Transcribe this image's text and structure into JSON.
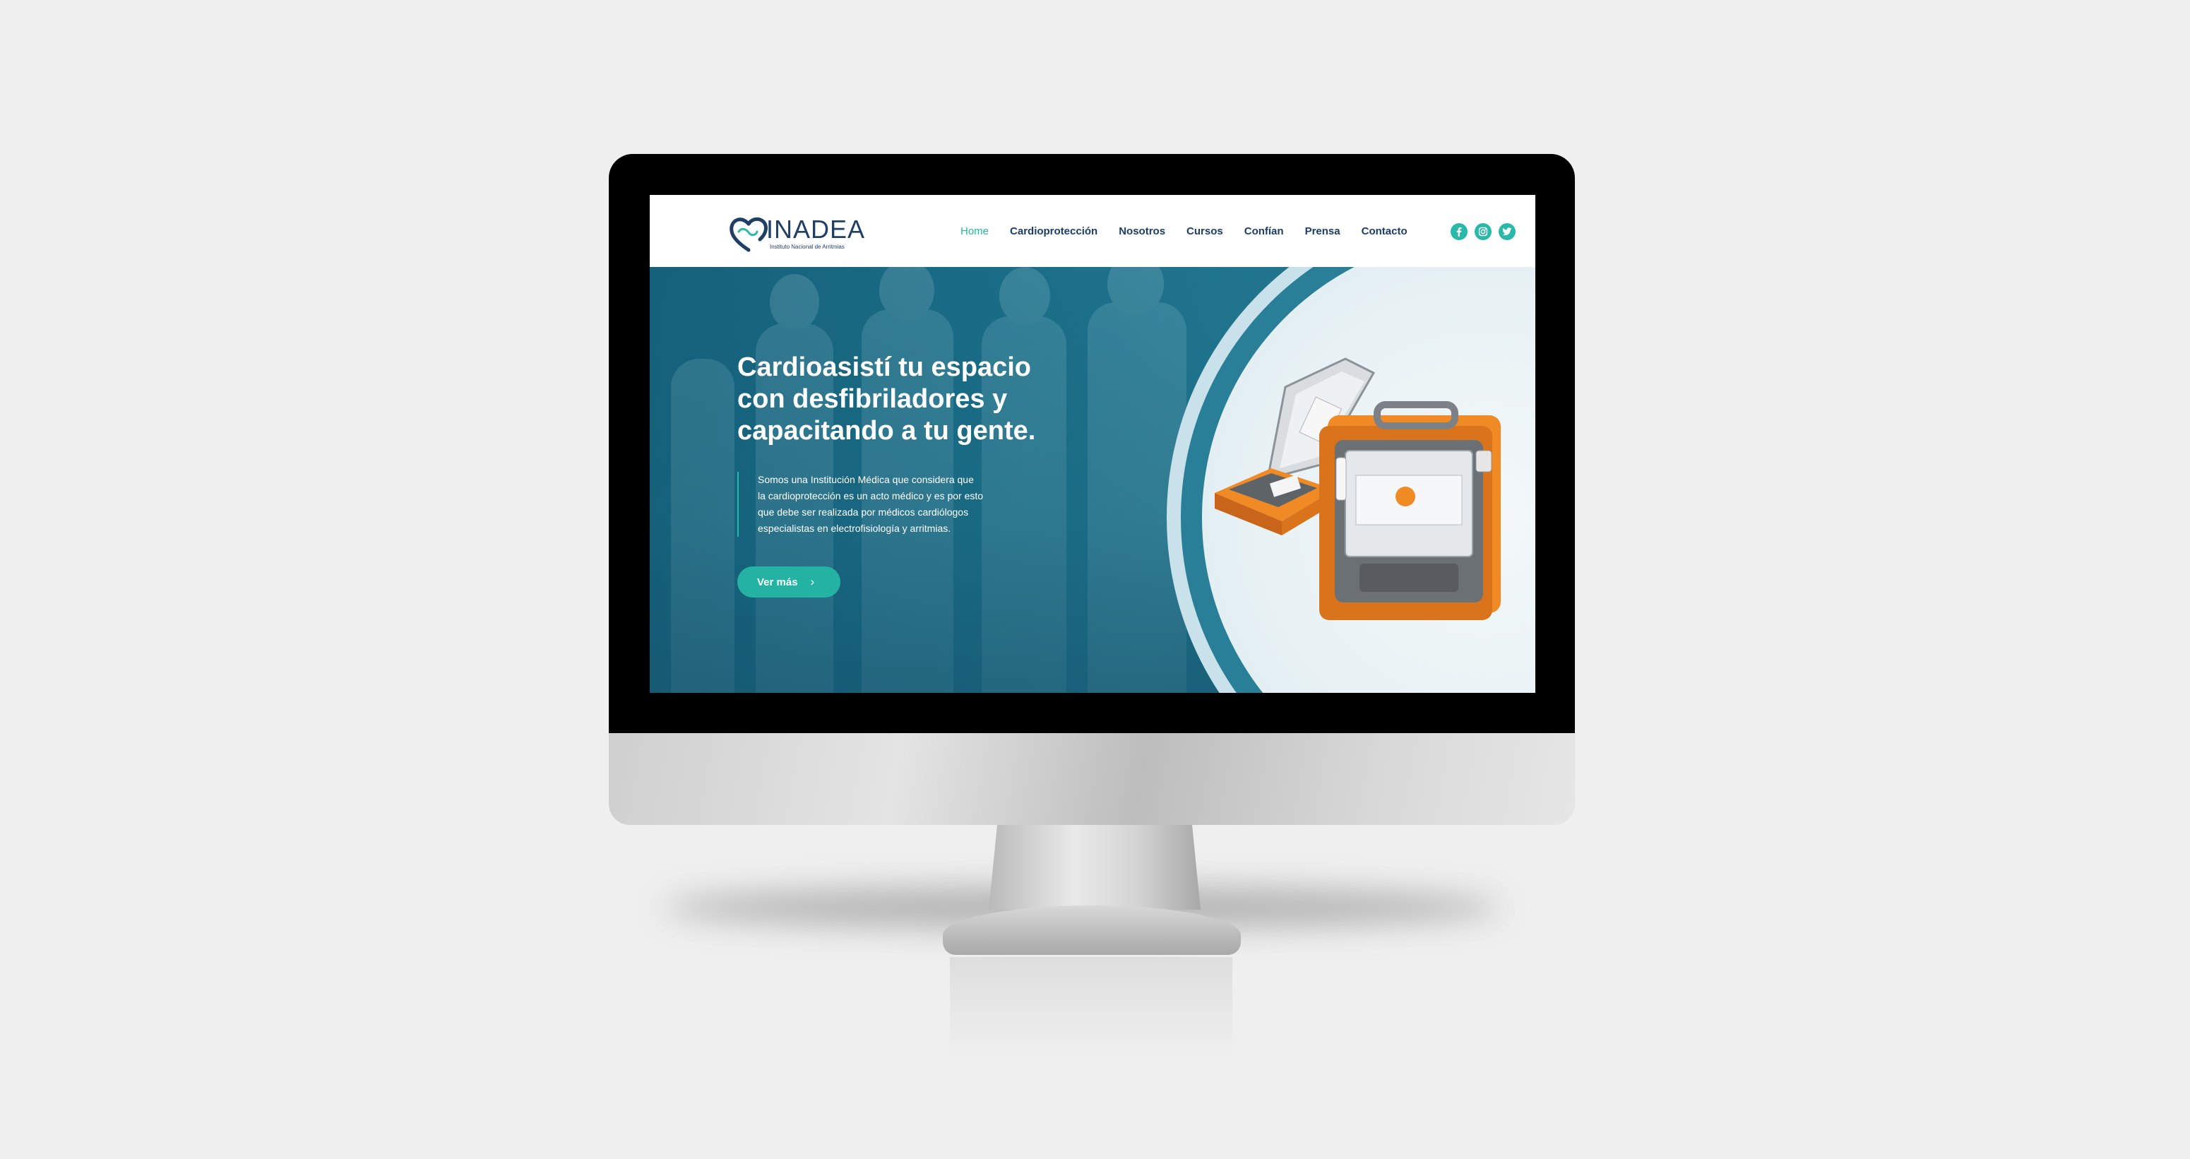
{
  "brand": {
    "name": "INADEA",
    "tagline": "Instituto Nacional de Arritmias"
  },
  "nav": {
    "items": [
      {
        "label": "Home",
        "active": true
      },
      {
        "label": "Cardioprotección",
        "active": false
      },
      {
        "label": "Nosotros",
        "active": false
      },
      {
        "label": "Cursos",
        "active": false
      },
      {
        "label": "Confían",
        "active": false
      },
      {
        "label": "Prensa",
        "active": false
      },
      {
        "label": "Contacto",
        "active": false
      }
    ]
  },
  "social": {
    "icons": [
      "facebook-icon",
      "instagram-icon",
      "twitter-icon"
    ]
  },
  "hero": {
    "headline": [
      "Cardioasistí tu espacio",
      "con desfibriladores y",
      "capacitando a tu gente."
    ],
    "description": [
      "Somos una Institución Médica que considera que",
      "la cardioprotección es un acto médico y es por esto",
      "que debe ser realizada por médicos cardiólogos",
      "especialistas en electrofisiología y arritmias."
    ],
    "cta_label": "Ver más",
    "cta_icon": "arrow-right-icon"
  },
  "colors": {
    "accent": "#24b3a2",
    "brand_dark": "#1c3d66",
    "hero_bg": "#1a6d87",
    "device_orange": "#f08a24"
  }
}
